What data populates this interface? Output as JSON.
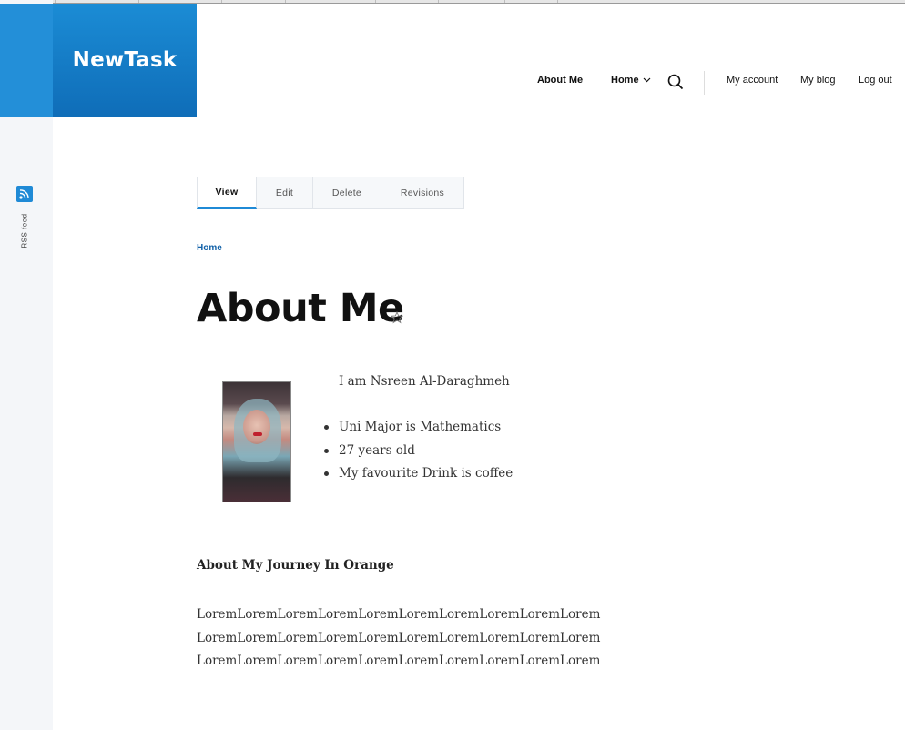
{
  "site": {
    "brand": "NewTask"
  },
  "sidebar": {
    "rss_label": "RSS feed",
    "rss_icon": "rss-icon"
  },
  "nav": {
    "about_me": "About Me",
    "home": "Home",
    "search_icon": "search-icon",
    "my_account": "My account",
    "my_blog": "My blog",
    "log_out": "Log out"
  },
  "tabs": [
    {
      "label": "View",
      "active": true
    },
    {
      "label": "Edit",
      "active": false
    },
    {
      "label": "Delete",
      "active": false
    },
    {
      "label": "Revisions",
      "active": false
    }
  ],
  "breadcrumb": {
    "home": "Home"
  },
  "page": {
    "title": "About Me",
    "intro": "I am Nsreen Al-Daraghmeh",
    "facts": [
      "Uni Major is Mathematics",
      "27 years old",
      "My favourite Drink is coffee"
    ],
    "journey_heading": "About My Journey In Orange",
    "lorem_lines": [
      "LoremLoremLoremLoremLoremLoremLoremLoremLoremLorem",
      "LoremLoremLoremLoremLoremLoremLoremLoremLoremLorem",
      "LoremLoremLoremLoremLoremLoremLoremLoremLoremLorem"
    ]
  },
  "colors": {
    "brand_blue": "#1b8cd5",
    "accent_blue": "#1f8ad6",
    "link_blue": "#1261a8"
  }
}
